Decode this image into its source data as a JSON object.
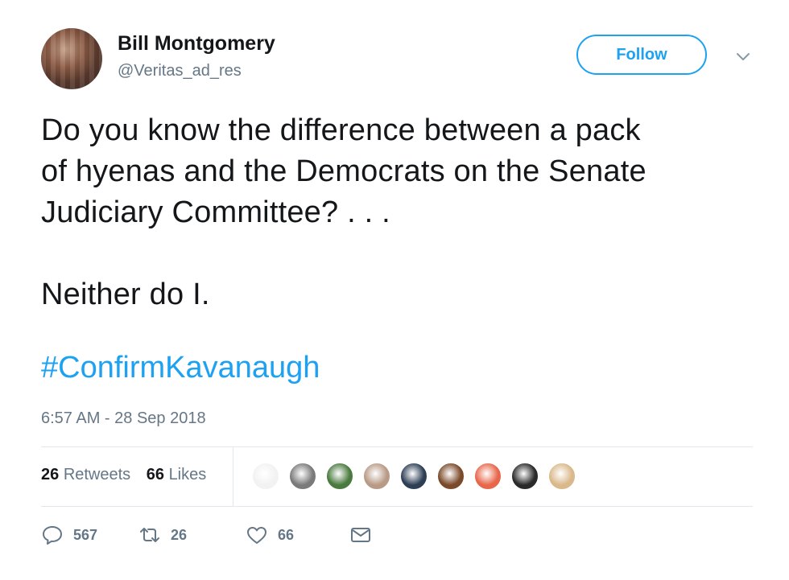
{
  "author": {
    "name": "Bill Montgomery",
    "handle": "@Veritas_ad_res"
  },
  "follow_label": "Follow",
  "tweet": {
    "lines": [
      "Do you know the difference between a pack",
      "of hyenas and the Democrats on the Senate",
      "Judiciary Committee? . . .",
      "Neither do I."
    ],
    "hashtag": "#ConfirmKavanaugh",
    "timestamp": "6:57 AM - 28 Sep 2018"
  },
  "stats": {
    "retweets_count": "26",
    "retweets_label": "Retweets",
    "likes_count": "66",
    "likes_label": "Likes"
  },
  "liker_avatars": [
    {
      "name": "liker-1",
      "color": "#f2f2f2"
    },
    {
      "name": "liker-2",
      "color": "#7a7a7a"
    },
    {
      "name": "liker-3",
      "color": "#4a7a3e"
    },
    {
      "name": "liker-4",
      "color": "#b89a86"
    },
    {
      "name": "liker-5",
      "color": "#2e3f55"
    },
    {
      "name": "liker-6",
      "color": "#7a4a2a"
    },
    {
      "name": "liker-7",
      "color": "#e8664a"
    },
    {
      "name": "liker-8",
      "color": "#2a2a2a"
    },
    {
      "name": "liker-9",
      "color": "#d9b88a"
    }
  ],
  "actions": {
    "reply_count": "567",
    "retweet_count": "26",
    "like_count": "66"
  },
  "colors": {
    "accent": "#1da1f2",
    "secondary_text": "#657786",
    "primary_text": "#14171a",
    "divider": "#e1e8ed"
  },
  "icons": [
    "reply-icon",
    "retweet-icon",
    "heart-icon",
    "envelope-icon",
    "chevron-down-icon"
  ]
}
